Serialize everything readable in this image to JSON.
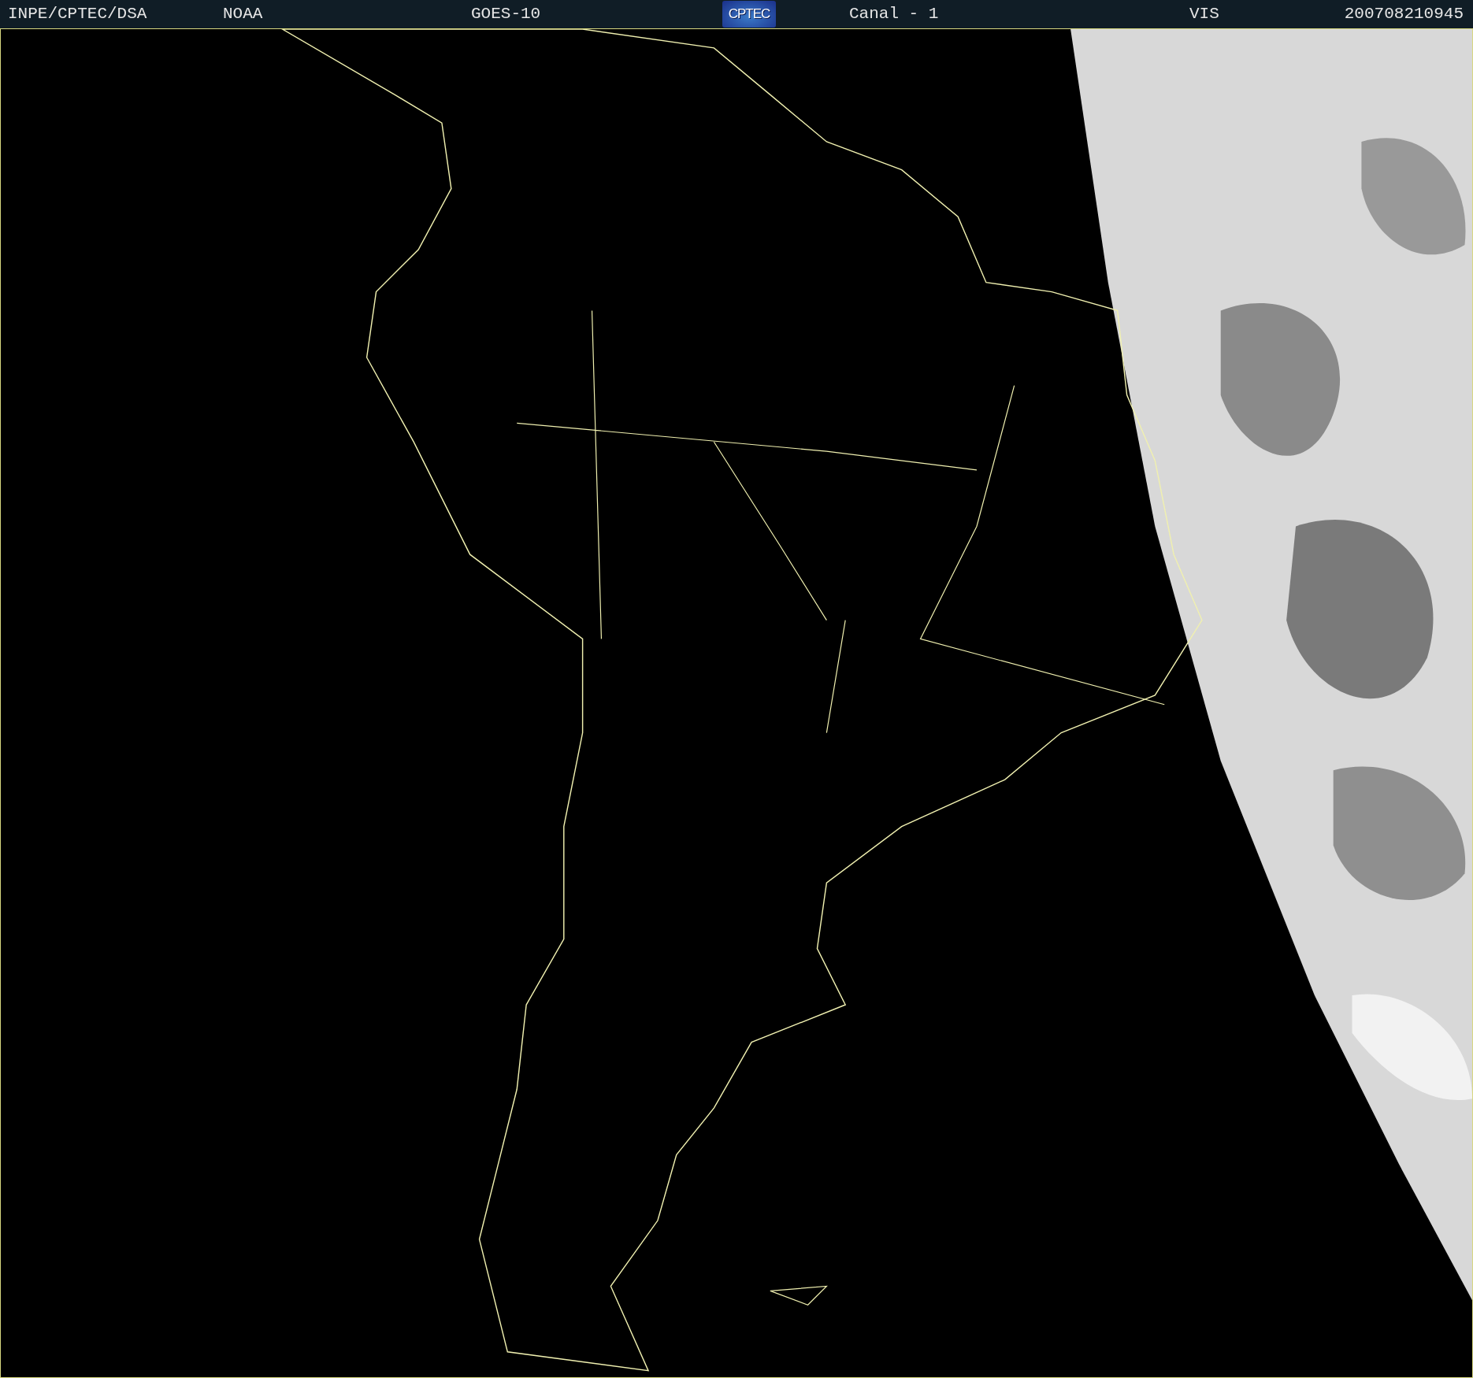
{
  "header": {
    "items": [
      {
        "kind": "text",
        "text": "INPE/CPTEC/DSA"
      },
      {
        "kind": "text",
        "text": "NOAA"
      },
      {
        "kind": "text",
        "text": "GOES-10"
      },
      {
        "kind": "logo",
        "text": "CPTEC"
      },
      {
        "kind": "text",
        "text": "Canal - 1"
      },
      {
        "kind": "text",
        "text": "VIS"
      },
      {
        "kind": "text",
        "text": "200708210945"
      }
    ]
  }
}
